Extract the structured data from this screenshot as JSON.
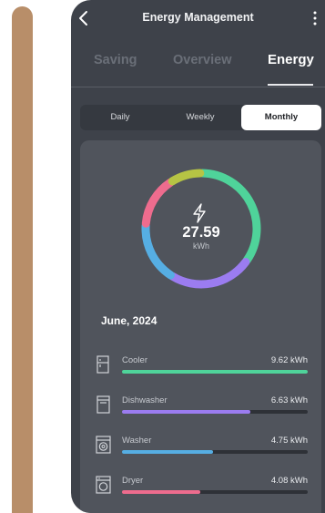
{
  "header": {
    "title": "Energy Management"
  },
  "tabs": [
    {
      "label": "Saving",
      "active": false
    },
    {
      "label": "Overview",
      "active": false
    },
    {
      "label": "Energy",
      "active": true
    }
  ],
  "periods": [
    {
      "label": "Daily",
      "selected": false
    },
    {
      "label": "Weekly",
      "selected": false
    },
    {
      "label": "Monthly",
      "selected": true
    }
  ],
  "summary": {
    "total": "27.59",
    "unit": "kWh",
    "period_label": "June, 2024",
    "icon": "lightning-bolt-icon"
  },
  "devices": [
    {
      "name": "Cooler",
      "value": "9.62 kWh",
      "kwh": 9.62,
      "share": 1.0,
      "color": "#4fd39a",
      "icon": "fridge-icon"
    },
    {
      "name": "Dishwasher",
      "value": "6.63 kWh",
      "kwh": 6.63,
      "share": 0.69,
      "color": "#9b7cf0",
      "icon": "dishwasher-icon"
    },
    {
      "name": "Washer",
      "value": "4.75 kWh",
      "kwh": 4.75,
      "share": 0.49,
      "color": "#56aee3",
      "icon": "washer-icon"
    },
    {
      "name": "Dryer",
      "value": "4.08 kWh",
      "kwh": 4.08,
      "share": 0.42,
      "color": "#ee6c8e",
      "icon": "dryer-icon"
    }
  ],
  "ring_extra": {
    "color": "#b6c444",
    "share": 0.09
  }
}
